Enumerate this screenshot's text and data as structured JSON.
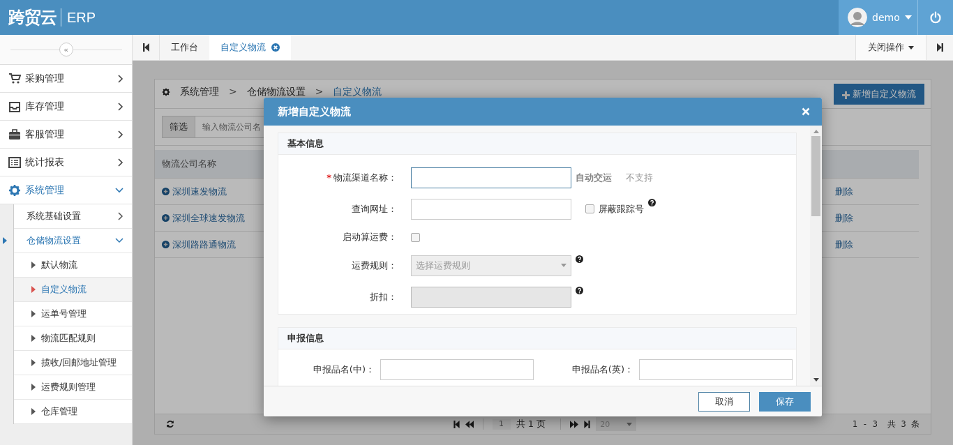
{
  "header": {
    "logo": "跨贸云",
    "product": "ERP",
    "user": "demo"
  },
  "sidebar": {
    "collapse_icon": "«",
    "items": [
      {
        "label": "采购管理",
        "selected": false,
        "expanded": false
      },
      {
        "label": "库存管理",
        "selected": false,
        "expanded": false
      },
      {
        "label": "客服管理",
        "selected": false,
        "expanded": false
      },
      {
        "label": "统计报表",
        "selected": false,
        "expanded": false
      },
      {
        "label": "系统管理",
        "selected": true,
        "expanded": true,
        "children": [
          {
            "label": "系统基础设置",
            "selected": false,
            "expanded": false
          },
          {
            "label": "仓储物流设置",
            "selected": true,
            "expanded": true,
            "children": [
              {
                "label": "默认物流",
                "selected": false
              },
              {
                "label": "自定义物流",
                "selected": true
              },
              {
                "label": "运单号管理",
                "selected": false
              },
              {
                "label": "物流匹配规则",
                "selected": false
              },
              {
                "label": "揽收/回邮地址管理",
                "selected": false
              },
              {
                "label": "运费规则管理",
                "selected": false
              },
              {
                "label": "仓库管理",
                "selected": false
              }
            ]
          }
        ]
      }
    ]
  },
  "tabs": [
    {
      "label": "工作台",
      "selected": false,
      "closable": false
    },
    {
      "label": "自定义物流",
      "selected": true,
      "closable": true
    }
  ],
  "close_menu": "关闭操作",
  "breadcrumb": {
    "separator": ">",
    "items": [
      "系统管理",
      "仓储物流设置",
      "自定义物流"
    ]
  },
  "add_button": "新增自定义物流",
  "filter": {
    "label": "筛选",
    "placeholder": "输入物流公司名"
  },
  "table": {
    "columns": [
      "物流公司名称"
    ],
    "rows": [
      {
        "name": "深圳速发物流",
        "action": "删除"
      },
      {
        "name": "深圳全球速发物流",
        "action": "删除"
      },
      {
        "name": "深圳路路通物流",
        "action": "删除"
      }
    ]
  },
  "pagination": {
    "page": "1",
    "total_pages": "共 1 页",
    "page_size": "20",
    "summary": "1 - 3  共 3 条"
  },
  "modal": {
    "title": "新增自定义物流",
    "sections": [
      {
        "title": "基本信息",
        "fields": [
          {
            "required_mark": "*",
            "label": "物流渠道名称：",
            "kind": "text",
            "focused": true,
            "disabled": false,
            "help": false,
            "notes": [
              {
                "text": "自动交运",
                "strong": true
              },
              {
                "text": "不支持",
                "strong": false
              }
            ]
          },
          {
            "label": "查询网址：",
            "kind": "text",
            "focused": false,
            "disabled": false,
            "help": true,
            "checkbox": {
              "label": "屏蔽跟踪号",
              "checked": false
            }
          },
          {
            "label": "启动算运费：",
            "kind": "checkbox",
            "checked": false,
            "help": false
          },
          {
            "label": "运费规则：",
            "kind": "select",
            "disabled": true,
            "placeholder": "选择运费规则",
            "help": true
          },
          {
            "label": "折扣：",
            "kind": "text",
            "focused": false,
            "disabled": true,
            "help": true
          }
        ]
      },
      {
        "title": "申报信息",
        "fields": [
          {
            "label": "申报品名(中)：",
            "kind": "text",
            "focused": false,
            "disabled": false,
            "help": false
          },
          {
            "label": "申报品名(英)：",
            "kind": "text",
            "focused": false,
            "disabled": false,
            "help": false
          }
        ]
      }
    ],
    "buttons": [
      {
        "label": "取消",
        "primary": false
      },
      {
        "label": "保存",
        "primary": true
      }
    ]
  }
}
